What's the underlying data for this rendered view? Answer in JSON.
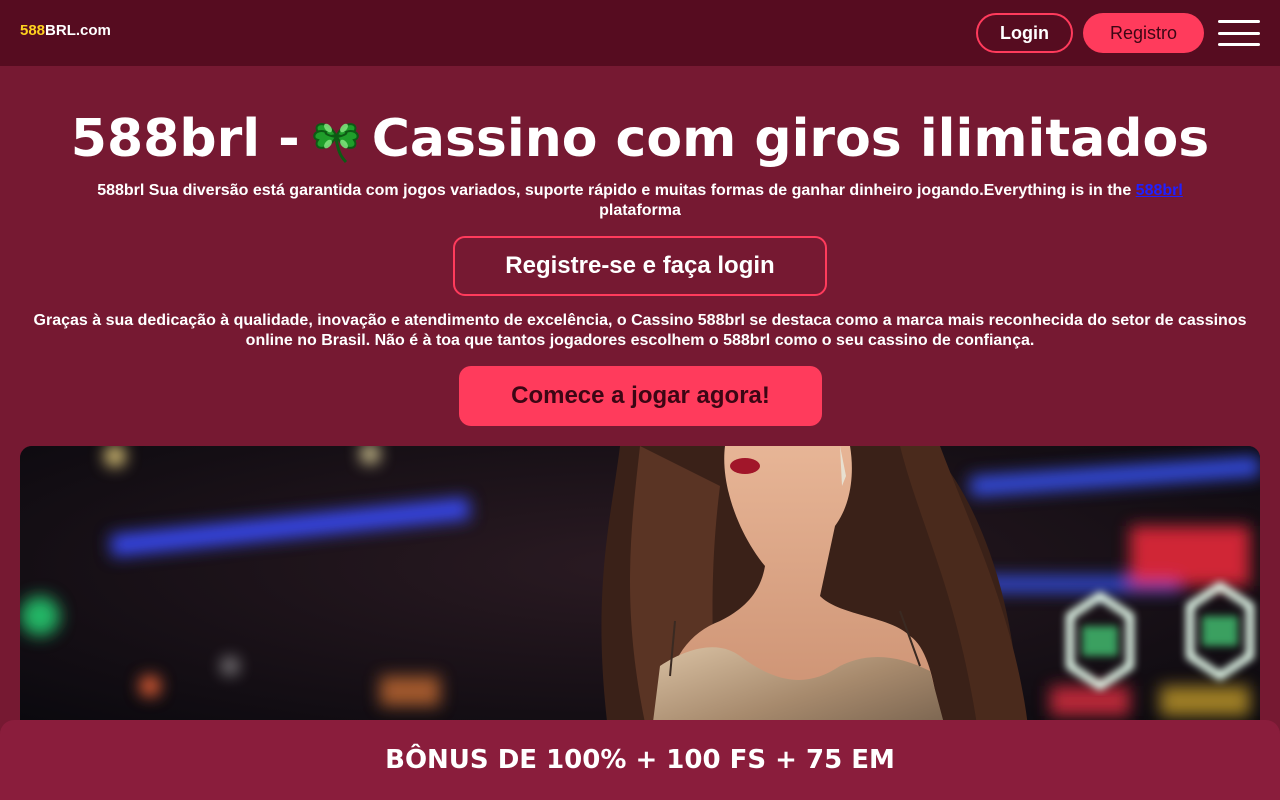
{
  "header": {
    "logo_number": "588",
    "logo_text": "BRL.com",
    "login_label": "Login",
    "register_label": "Registro"
  },
  "hero": {
    "title_before": "588brl -",
    "title_after": "Cassino com giros ilimitados",
    "subtitle_text": "588brl Sua diversão está garantida com jogos variados, suporte rápido e muitas formas de ganhar dinheiro jogando.Everything is in the ",
    "subtitle_link": "588brl",
    "subtitle_end": " plataforma",
    "register_login_button": "Registre-se e faça login",
    "paragraph": "Graças à sua dedicação à qualidade, inovação e atendimento de excelência, o Cassino 588brl se destaca como a marca mais reconhecida do setor de cassinos online no Brasil. Não é à toa que tantos jogadores escolhem o 588brl como o seu cassino de confiança.",
    "play_button": "Comece a jogar agora!"
  },
  "bonus_bar": {
    "text": "BÔNUS DE 100% + 100 FS + 75 EM"
  },
  "icons": {
    "clover": "four-leaf-clover-icon",
    "menu": "hamburger-menu-icon"
  },
  "colors": {
    "background": "#761932",
    "header": "#560c20",
    "accent": "#ff3b5c",
    "logo_number": "#ffd21f",
    "bonus_bar": "#8a1d3c"
  }
}
